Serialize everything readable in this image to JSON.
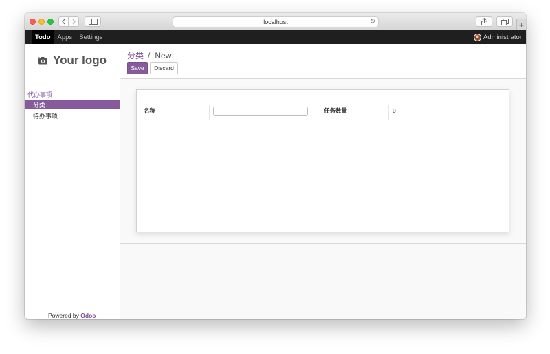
{
  "browser": {
    "address": "localhost"
  },
  "topnav": {
    "apps": [
      {
        "label": "Todo",
        "active": true
      },
      {
        "label": "Apps",
        "active": false
      },
      {
        "label": "Settings",
        "active": false
      }
    ],
    "user": "Administrator"
  },
  "sidebar": {
    "logo_text": "Your logo",
    "section": "代办事项",
    "items": [
      {
        "label": "分类",
        "active": true
      },
      {
        "label": "待办事项",
        "active": false
      }
    ],
    "powered_prefix": "Powered by",
    "powered_brand": "Odoo"
  },
  "control_panel": {
    "breadcrumb_parent": "分类",
    "breadcrumb_separator": "/",
    "breadcrumb_current": "New",
    "save_label": "Save",
    "discard_label": "Discard"
  },
  "form": {
    "name_label": "名称",
    "name_value": "",
    "count_label": "任务数量",
    "count_value": "0"
  },
  "colors": {
    "accent": "#875a9b",
    "link": "#7c5295",
    "navbar": "#1f1f1f"
  },
  "icons": {
    "back": "chevron-left-icon",
    "forward": "chevron-right-icon",
    "sidebar_toggle": "sidebar-icon",
    "reload": "reload-icon",
    "share": "share-icon",
    "tabs": "tabs-icon",
    "new_tab": "plus-icon",
    "logo": "camera-icon",
    "user": "avatar"
  }
}
